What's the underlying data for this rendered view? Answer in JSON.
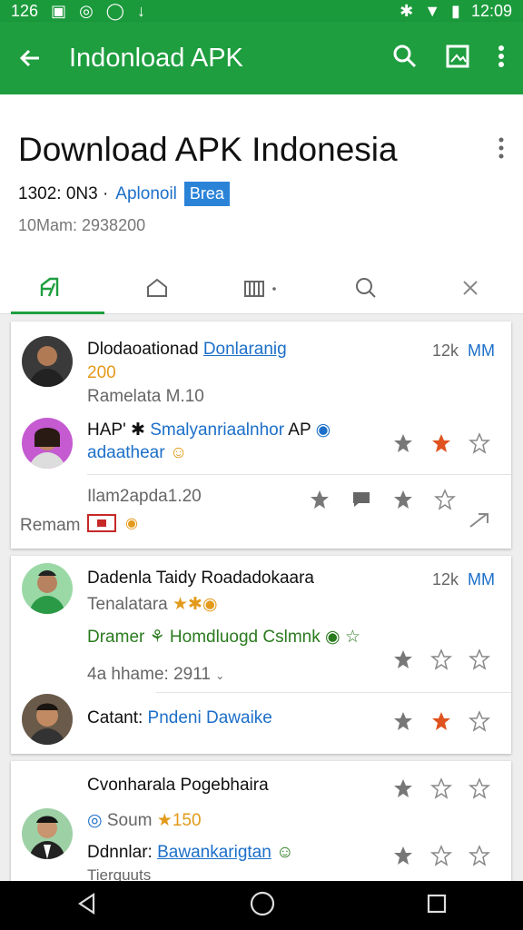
{
  "status_bar": {
    "time_left": "126",
    "time": "12:09"
  },
  "app_bar": {
    "title": "Indonload APK"
  },
  "header": {
    "title": "Download APK Indonesia",
    "meta_prefix": "1302: 0N3 ·",
    "meta_link": "Aplonoil",
    "badge": "Brea",
    "sub": "10Mam: 2938200"
  },
  "cards": [
    {
      "name": "Dlodaoationad",
      "name_link": "Donlaranig",
      "count": "12k",
      "count_tag": "MM",
      "number": "200",
      "line2": "Ramelata M.10",
      "reply_prefix": "HAP' ✱",
      "reply_link": "Smalyanriaalnhor",
      "reply_suffix": "AP",
      "reply_line2": "adaathear",
      "footer_top": "Ilam2apda1.20",
      "footer_label": "Remam"
    },
    {
      "name": "Dadenla Taidy Roadadokaara",
      "count": "12k",
      "count_tag": "MM",
      "line2": "Tenalatara",
      "green_line": "Dramer ⚘ Homdluogd Cslmnk",
      "line4": "4a hhame: 2911",
      "reply_label": "Catant:",
      "reply_link": "Pndeni Dawaike"
    },
    {
      "name": "Cvonharala Pogebhaira",
      "meta_prefix": "Soum",
      "meta_num": "150",
      "reply_label": "Ddnnlar:",
      "reply_link": "Bawankarigtan",
      "footer": "Tierquuts"
    }
  ],
  "colors": {
    "primary": "#1e9e3f",
    "accent": "#2b83d8",
    "star_active": "#e0531f"
  }
}
